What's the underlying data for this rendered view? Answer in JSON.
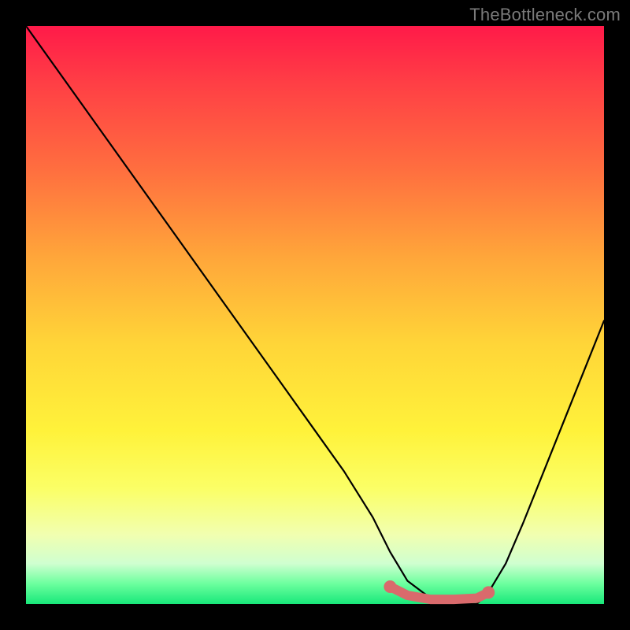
{
  "watermark": "TheBottleneck.com",
  "colors": {
    "curve": "#000000",
    "accent": "#d96a6c",
    "accent_fill": "#d96a6c"
  },
  "chart_data": {
    "type": "line",
    "title": "",
    "xlabel": "",
    "ylabel": "",
    "xlim": [
      0,
      100
    ],
    "ylim": [
      0,
      100
    ],
    "grid": false,
    "legend": false,
    "annotations": [],
    "series": [
      {
        "name": "bottleneck-curve",
        "x": [
          0,
          5,
          10,
          15,
          20,
          25,
          30,
          35,
          40,
          45,
          50,
          55,
          60,
          63,
          66,
          70,
          74,
          78,
          80,
          83,
          86,
          90,
          94,
          98,
          100
        ],
        "values": [
          100,
          93,
          86,
          79,
          72,
          65,
          58,
          51,
          44,
          37,
          30,
          23,
          15,
          9,
          4,
          1,
          0,
          0,
          2,
          7,
          14,
          24,
          34,
          44,
          49
        ]
      }
    ],
    "accent_segment": {
      "name": "optimal-range",
      "x": [
        63,
        66,
        70,
        74,
        78,
        80
      ],
      "values": [
        3.0,
        1.5,
        0.8,
        0.8,
        1.0,
        2.0
      ]
    },
    "accent_endpoints": [
      {
        "x": 63,
        "y": 3.0
      },
      {
        "x": 80,
        "y": 2.0
      }
    ]
  }
}
